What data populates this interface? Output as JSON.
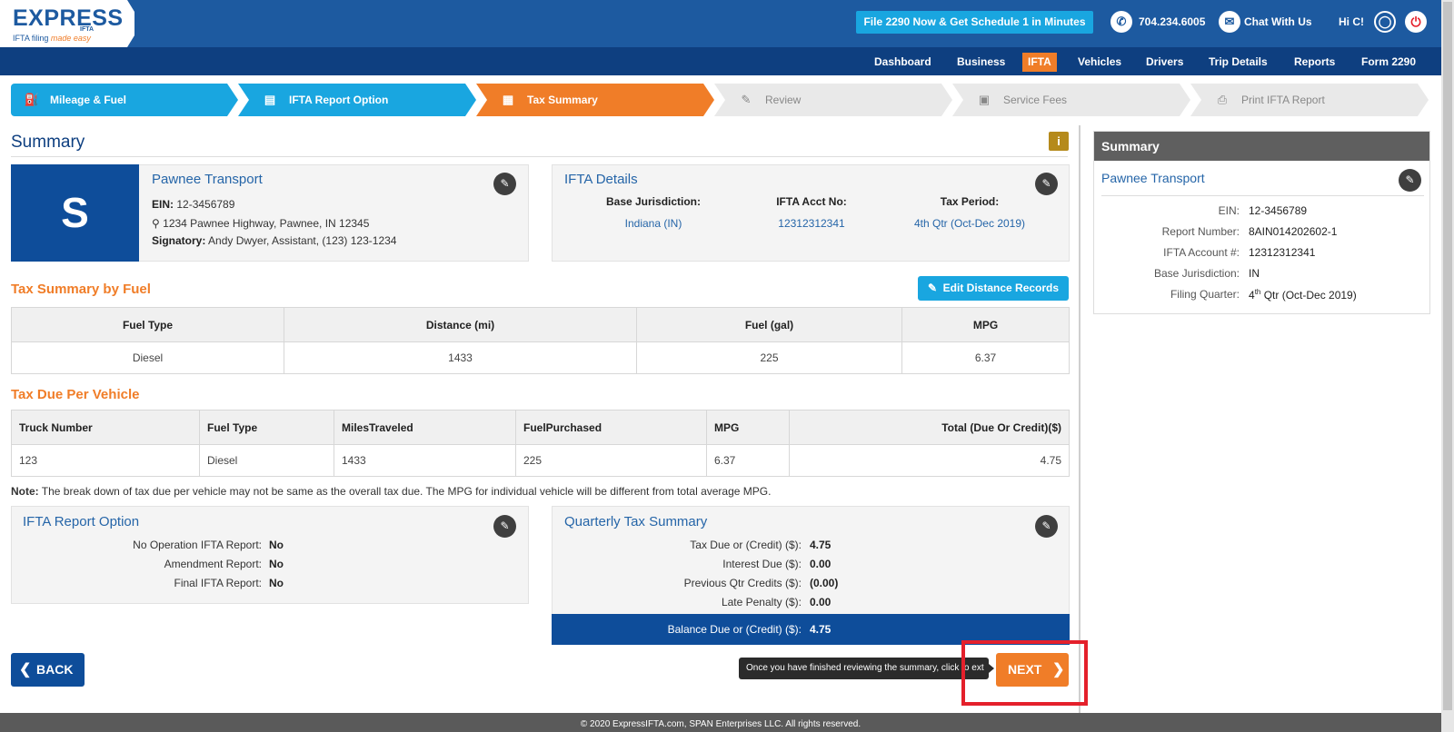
{
  "header": {
    "logo_title": "EXPRESS",
    "logo_ifta": "IFTA",
    "logo_tagline": "IFTA filing",
    "logo_tagline_script": "made easy",
    "promo_button": "File 2290 Now & Get Schedule 1 in Minutes",
    "phone": "704.234.6005",
    "chat": "Chat With Us",
    "greeting": "Hi C!"
  },
  "nav": {
    "items": [
      "Dashboard",
      "Business",
      "IFTA",
      "Vehicles",
      "Drivers",
      "Trip Details",
      "Reports",
      "Form 2290"
    ],
    "active": "IFTA"
  },
  "steps": [
    {
      "label": "Mileage & Fuel",
      "icon": "fuel-pump-icon",
      "state": "done"
    },
    {
      "label": "IFTA Report Option",
      "icon": "report-icon",
      "state": "done"
    },
    {
      "label": "Tax Summary",
      "icon": "summary-icon",
      "state": "current"
    },
    {
      "label": "Review",
      "icon": "review-icon",
      "state": "todo"
    },
    {
      "label": "Service Fees",
      "icon": "fees-icon",
      "state": "todo"
    },
    {
      "label": "Print IFTA Report",
      "icon": "printer-icon",
      "state": "todo"
    }
  ],
  "page_title": "Summary",
  "business": {
    "avatar_letter": "S",
    "name": "Pawnee Transport",
    "ein_label": "EIN:",
    "ein": "12-3456789",
    "address": "1234 Pawnee Highway, Pawnee, IN 12345",
    "signatory_label": "Signatory:",
    "signatory": "Andy Dwyer, Assistant, (123) 123-1234"
  },
  "ifta_details": {
    "title": "IFTA Details",
    "cols": [
      {
        "label": "Base Jurisdiction:",
        "value": "Indiana (IN)"
      },
      {
        "label": "IFTA Acct No:",
        "value": "12312312341"
      },
      {
        "label": "Tax Period:",
        "value": "4th Qtr (Oct-Dec 2019)"
      }
    ]
  },
  "fuel_summary": {
    "heading": "Tax Summary by Fuel",
    "edit_button": "Edit Distance Records",
    "headers": [
      "Fuel Type",
      "Distance (mi)",
      "Fuel (gal)",
      "MPG"
    ],
    "rows": [
      [
        "Diesel",
        "1433",
        "225",
        "6.37"
      ]
    ]
  },
  "vehicle_tax": {
    "heading": "Tax Due Per Vehicle",
    "headers": [
      "Truck Number",
      "Fuel Type",
      "MilesTraveled",
      "FuelPurchased",
      "MPG",
      "Total (Due Or Credit)($)"
    ],
    "rows": [
      [
        "123",
        "Diesel",
        "1433",
        "225",
        "6.37",
        "4.75"
      ]
    ]
  },
  "note": {
    "label": "Note:",
    "text": "The break down of tax due per vehicle may not be same as the overall tax due. The MPG for individual vehicle will be different from total average MPG."
  },
  "report_option": {
    "title": "IFTA Report Option",
    "rows": [
      {
        "label": "No Operation IFTA Report:",
        "value": "No"
      },
      {
        "label": "Amendment Report:",
        "value": "No"
      },
      {
        "label": "Final IFTA Report:",
        "value": "No"
      }
    ]
  },
  "quarterly": {
    "title": "Quarterly Tax Summary",
    "rows": [
      {
        "label": "Tax Due or (Credit) ($):",
        "value": "4.75"
      },
      {
        "label": "Interest Due ($):",
        "value": "0.00"
      },
      {
        "label": "Previous Qtr Credits ($):",
        "value": "(0.00)"
      },
      {
        "label": "Late Penalty ($):",
        "value": "0.00"
      }
    ],
    "balance_label": "Balance Due or (Credit) ($):",
    "balance_value": "4.75"
  },
  "actions": {
    "back": "BACK",
    "next": "NEXT",
    "tooltip": "Once you have finished reviewing the summary, click to ext"
  },
  "footer": "© 2020 ExpressIFTA.com, SPAN Enterprises LLC. All rights reserved.",
  "right_summary": {
    "title": "Summary",
    "company": "Pawnee Transport",
    "rows": [
      {
        "label": "EIN:",
        "value": "12-3456789"
      },
      {
        "label": "Report Number:",
        "value": "8AIN014202602-1"
      },
      {
        "label": "IFTA Account #:",
        "value": "12312312341"
      },
      {
        "label": "Base Jurisdiction:",
        "value": "IN"
      }
    ],
    "filing_label": "Filing Quarter:",
    "filing_num": "4",
    "filing_sup": "th",
    "filing_rest": " Qtr (Oct-Dec 2019)"
  },
  "colors": {
    "brand_blue": "#1d5aa0",
    "nav_blue": "#0e3f80",
    "accent_orange": "#f07d28",
    "step_done": "#19a6e0",
    "highlight_red": "#e4202b"
  }
}
